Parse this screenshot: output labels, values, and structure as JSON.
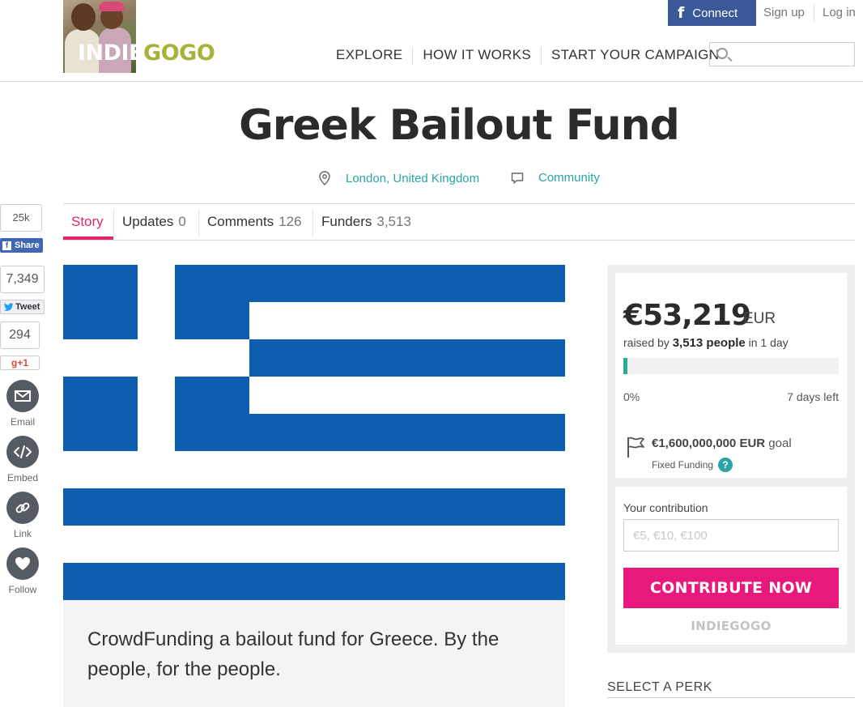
{
  "header": {
    "logo": {
      "indie": "INDIE",
      "gogo": "GOGO"
    },
    "facebook_connect": "Connect",
    "sign_up": "Sign up",
    "log_in": "Log in",
    "nav": [
      "EXPLORE",
      "HOW IT WORKS",
      "START YOUR CAMPAIGN"
    ],
    "search": {
      "placeholder": "",
      "value": ""
    }
  },
  "campaign": {
    "title": "Greek Bailout Fund",
    "location": "London, United Kingdom",
    "category": "Community"
  },
  "tabs": [
    {
      "label": "Story",
      "count": "",
      "active": true
    },
    {
      "label": "Updates",
      "count": "0",
      "active": false
    },
    {
      "label": "Comments",
      "count": "126",
      "active": false
    },
    {
      "label": "Funders",
      "count": "3,513",
      "active": false
    }
  ],
  "share": {
    "facebook_count": "25k",
    "facebook_label": "Share",
    "twitter_count": "7,349",
    "twitter_label": "Tweet",
    "gplus_count": "294",
    "gplus_label": "g+1",
    "email_label": "Email",
    "embed_label": "Embed",
    "link_label": "Link",
    "follow_label": "Follow"
  },
  "story": {
    "pitch": "CrowdFunding a bailout fund for Greece. By the people, for the people."
  },
  "funding": {
    "amount": "€53,219",
    "currency": "EUR",
    "raised_prefix": "raised by",
    "people": "3,513 people",
    "raised_suffix": "in 1 day",
    "progress_percent": 0,
    "progress_label": "0%",
    "days_left": "7 days left",
    "goal_amount": "€1,600,000,000",
    "goal_currency": "EUR",
    "goal_suffix": "goal",
    "funding_type": "Fixed Funding",
    "help": "?"
  },
  "contribute": {
    "label": "Your contribution",
    "placeholder": "€5, €10, €100",
    "value": "",
    "button": "CONTRIBUTE NOW",
    "powered_by": "INDIEGOGO"
  },
  "perks": {
    "title": "SELECT A PERK"
  },
  "colors": {
    "accent_pink": "#e1266c",
    "teal": "#2aa4a8",
    "facebook_blue": "#3b5998",
    "greek_blue": "#0d5eaf"
  }
}
